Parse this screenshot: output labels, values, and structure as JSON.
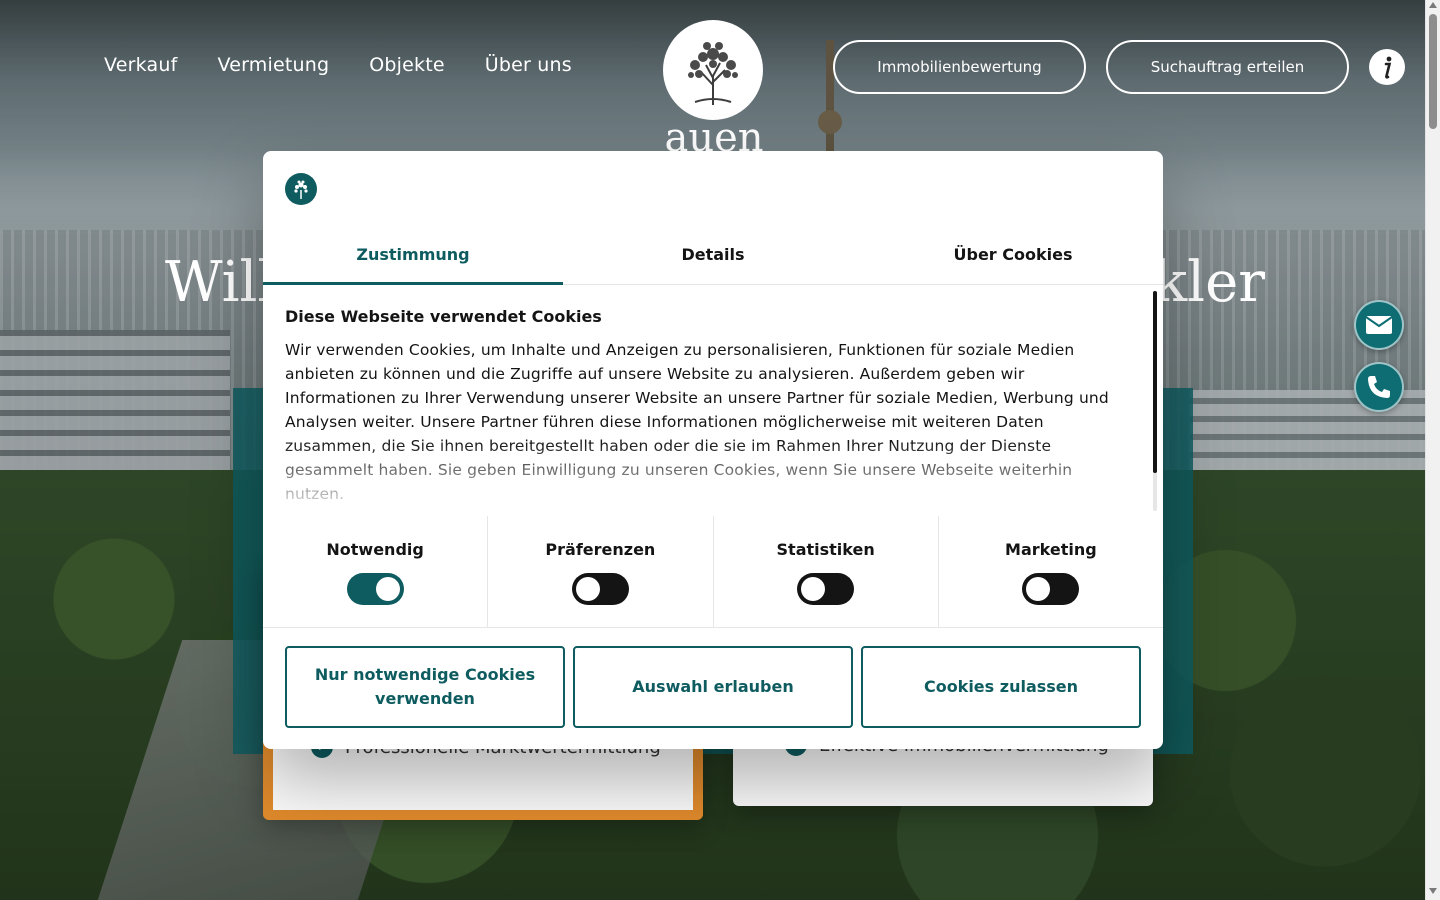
{
  "header": {
    "nav": [
      "Verkauf",
      "Vermietung",
      "Objekte",
      "Über uns"
    ],
    "logo_word": "auen",
    "buttons": {
      "valuation": "Immobilienbewertung",
      "search_order": "Suchauftrag erteilen"
    },
    "info_icon": "info-icon"
  },
  "hero": {
    "title_left": "Will",
    "title_right": "kler",
    "card1_feature": "Professionelle Marktwertermittlung",
    "card2_feature": "Effektive Immobilienvermittlung"
  },
  "floating": {
    "mail_icon": "mail-icon",
    "phone_icon": "phone-icon"
  },
  "cookie": {
    "tabs": [
      "Zustimmung",
      "Details",
      "Über Cookies"
    ],
    "heading": "Diese Webseite verwendet Cookies",
    "text": "Wir verwenden Cookies, um Inhalte und Anzeigen zu personalisieren, Funktionen für soziale Medien anbieten zu können und die Zugriffe auf unsere Website zu analysieren. Außerdem geben wir Informationen zu Ihrer Verwendung unserer Website an unsere Partner für soziale Medien, Werbung und Analysen weiter. Unsere Partner führen diese Informationen möglicherweise mit weiteren Daten zusammen, die Sie ihnen bereitgestellt haben oder die sie im Rahmen Ihrer Nutzung der Dienste gesammelt haben. Sie geben Einwilligung zu unseren Cookies, wenn Sie unsere Webseite weiterhin nutzen.",
    "categories": [
      {
        "label": "Notwendig",
        "enabled": true
      },
      {
        "label": "Präferenzen",
        "enabled": false
      },
      {
        "label": "Statistiken",
        "enabled": false
      },
      {
        "label": "Marketing",
        "enabled": false
      }
    ],
    "buttons": {
      "necessary_only": "Nur notwendige Cookies verwenden",
      "allow_selection": "Auswahl erlauben",
      "allow_all": "Cookies zulassen"
    }
  },
  "colors": {
    "brand_teal": "#0e5c60",
    "accent_orange": "#e08a2c",
    "toggle_off": "#141414"
  }
}
